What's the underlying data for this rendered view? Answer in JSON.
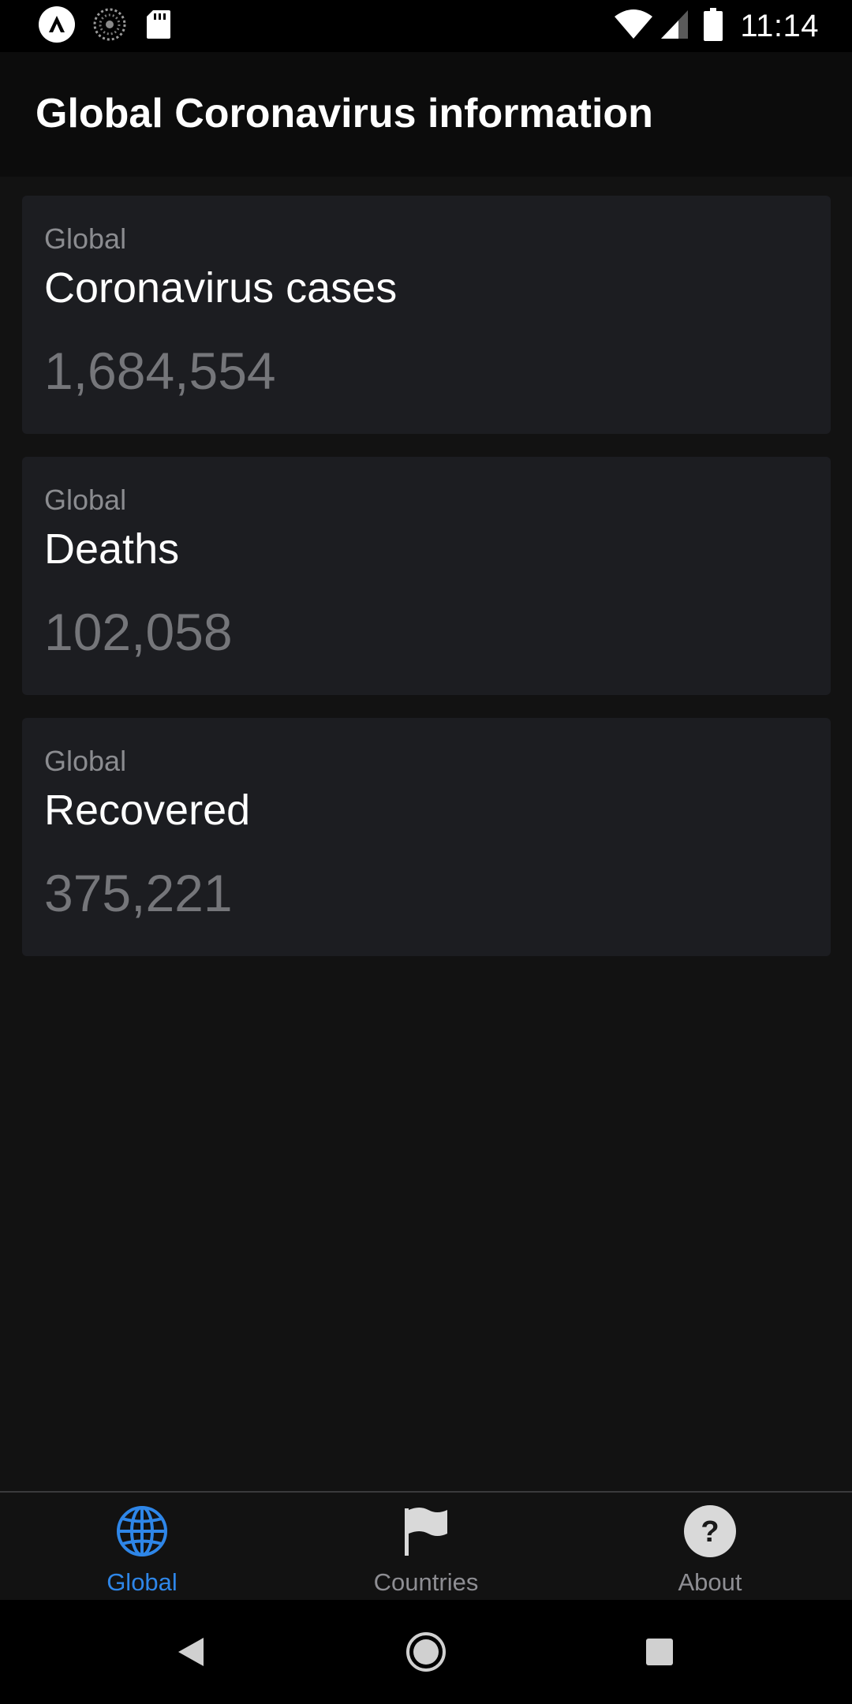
{
  "status_bar": {
    "time": "11:14",
    "icons_left": [
      "app-notification-icon",
      "sync-icon",
      "sd-card-icon"
    ],
    "icons_right": [
      "wifi-icon",
      "cellular-signal-icon",
      "battery-icon"
    ]
  },
  "app_bar": {
    "title": "Global Coronavirus information"
  },
  "cards": [
    {
      "scope": "Global",
      "title": "Coronavirus cases",
      "value": "1,684,554"
    },
    {
      "scope": "Global",
      "title": "Deaths",
      "value": "102,058"
    },
    {
      "scope": "Global",
      "title": "Recovered",
      "value": "375,221"
    }
  ],
  "bottom_nav": {
    "active_color": "#2e86e8",
    "inactive_color": "#8e8e93",
    "items": [
      {
        "label": "Global",
        "icon": "globe-icon",
        "active": true
      },
      {
        "label": "Countries",
        "icon": "flag-icon",
        "active": false
      },
      {
        "label": "About",
        "icon": "help-icon",
        "active": false
      }
    ]
  },
  "system_nav": {
    "buttons": [
      "back-icon",
      "home-icon",
      "recents-icon"
    ]
  }
}
